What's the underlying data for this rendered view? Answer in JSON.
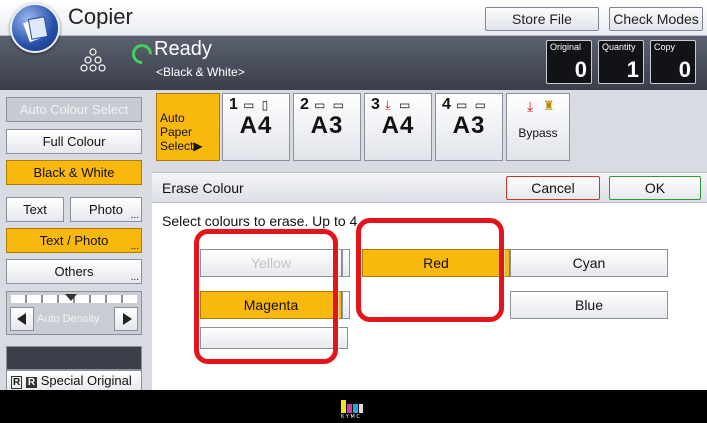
{
  "app": {
    "title": "Copier",
    "icon": "copier-logo-icon"
  },
  "toolbar": {
    "store_file": "Store File",
    "check_modes": "Check Modes"
  },
  "status": {
    "state": "Ready",
    "mode": "<Black & White>",
    "icons": [
      "copies-icon",
      "spinner-icon"
    ],
    "counters": [
      {
        "label": "Original",
        "value": "0"
      },
      {
        "label": "Quantity",
        "value": "1"
      },
      {
        "label": "Copy",
        "value": "0"
      }
    ]
  },
  "sidebar": {
    "auto_colour_select": "Auto Colour Select",
    "full_colour": "Full Colour",
    "black_white": "Black & White",
    "text": "Text",
    "photo": "Photo",
    "text_photo": "Text / Photo",
    "others": "Others",
    "auto_density": "Auto Density",
    "special_original": "Special Original",
    "more_mark": "..."
  },
  "paper": {
    "auto_paper_select": "Auto Paper Select",
    "arrow": "▶",
    "trays": [
      {
        "num": "1",
        "size": "A4"
      },
      {
        "num": "2",
        "size": "A3"
      },
      {
        "num": "3",
        "size": "A4"
      },
      {
        "num": "4",
        "size": "A3"
      }
    ],
    "bypass": "Bypass"
  },
  "erase": {
    "title": "Erase Colour",
    "cancel": "Cancel",
    "ok": "OK",
    "instruction": "Select colours to erase. Up to 4",
    "colours": {
      "yellow": "Yellow",
      "red": "Red",
      "cyan": "Cyan",
      "magenta": "Magenta",
      "blue": "Blue"
    }
  },
  "colors": {
    "accent": "#f9b80d",
    "highlight": "#e3141b",
    "ready": "#3fd15a",
    "ok_border": "#2e9a37",
    "cancel_border": "#c0392b"
  }
}
